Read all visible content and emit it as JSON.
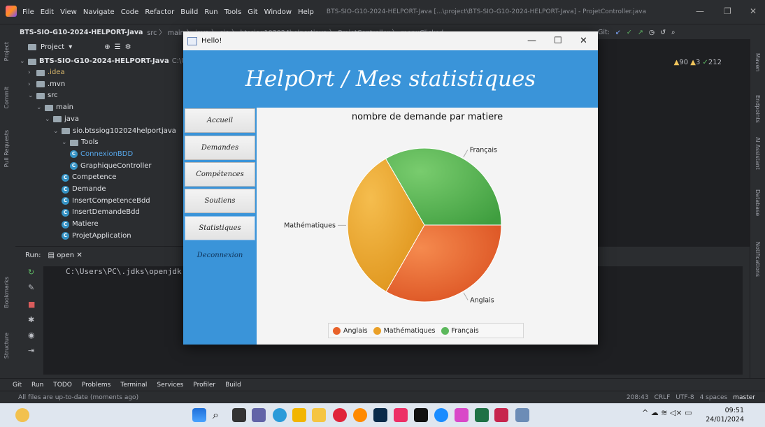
{
  "ide": {
    "menu": [
      "File",
      "Edit",
      "View",
      "Navigate",
      "Code",
      "Refactor",
      "Build",
      "Run",
      "Tools",
      "Git",
      "Window",
      "Help"
    ],
    "window_title": "BTS-SIO-G10-2024-HELPORT-Java [...\\project\\BTS-SIO-G10-2024-HELPORT-Java] - ProjetController.java",
    "breadcrumb_root": "BTS-SIO-G10-2024-HELPORT-Java",
    "breadcrumb_rest": "src 〉 main 〉 java 〉 sio 〉 btssiog102024helportjava 〉 ProjetController 〉 menuClicked",
    "git_label": "Git:",
    "run_config": "open",
    "inspections": {
      "warnings": "90",
      "weak": "3",
      "ok": "212"
    }
  },
  "left_strip": [
    "Project",
    "Commit",
    "Pull Requests",
    "Bookmarks",
    "Structure"
  ],
  "right_strip": [
    "Maven",
    "Endpoints",
    "AI Assistant",
    "Database",
    "Notifications"
  ],
  "project_panel": {
    "title": "Project",
    "root": "BTS-SIO-G10-2024-HELPORT-Java",
    "root_path": "C:\\Us",
    "items": [
      {
        "label": ".idea",
        "kind": "folder",
        "indent": 1
      },
      {
        "label": ".mvn",
        "kind": "folder",
        "indent": 1
      },
      {
        "label": "src",
        "kind": "folder",
        "indent": 1
      },
      {
        "label": "main",
        "kind": "folder",
        "indent": 2
      },
      {
        "label": "java",
        "kind": "folder",
        "indent": 3
      },
      {
        "label": "sio.btssiog102024helportjava",
        "kind": "folder",
        "indent": 4
      },
      {
        "label": "Tools",
        "kind": "folder",
        "indent": 5
      },
      {
        "label": "ConnexionBDD",
        "kind": "class",
        "indent": 6
      },
      {
        "label": "GraphiqueController",
        "kind": "class",
        "indent": 6
      },
      {
        "label": "Competence",
        "kind": "class",
        "indent": 5
      },
      {
        "label": "Demande",
        "kind": "class",
        "indent": 5
      },
      {
        "label": "InsertCompetenceBdd",
        "kind": "class",
        "indent": 5
      },
      {
        "label": "InsertDemandeBdd",
        "kind": "class",
        "indent": 5
      },
      {
        "label": "Matiere",
        "kind": "class",
        "indent": 5
      },
      {
        "label": "ProjetApplication",
        "kind": "class",
        "indent": 5
      }
    ]
  },
  "run_panel": {
    "label": "Run:",
    "tab": "open",
    "console_line": "C:\\Users\\PC\\.jdks\\openjdk"
  },
  "bottom_tools": [
    "Git",
    "Run",
    "TODO",
    "Problems",
    "Terminal",
    "Services",
    "Profiler",
    "Build"
  ],
  "status": {
    "message": "All files are up-to-date (moments ago)",
    "position": "208:43",
    "line_sep": "CRLF",
    "encoding": "UTF-8",
    "indent": "4 spaces",
    "branch": "master"
  },
  "taskbar": {
    "time": "09:51",
    "date": "24/01/2024"
  },
  "app": {
    "window_title": "Hello!",
    "banner": "HelpOrt / Mes statistiques",
    "nav": [
      "Accueil",
      "Demandes",
      "Compétences",
      "Soutiens",
      "Statistiques"
    ],
    "active_nav": "Statistiques",
    "logout": "Deconnexion"
  },
  "chart_data": {
    "type": "pie",
    "title": "nombre de demande par matiere",
    "categories": [
      "Anglais",
      "Mathématiques",
      "Français"
    ],
    "values": [
      33.3,
      33.3,
      33.4
    ],
    "colors": [
      "#e8622a",
      "#eaa028",
      "#5cb85c"
    ],
    "legend_position": "bottom"
  }
}
